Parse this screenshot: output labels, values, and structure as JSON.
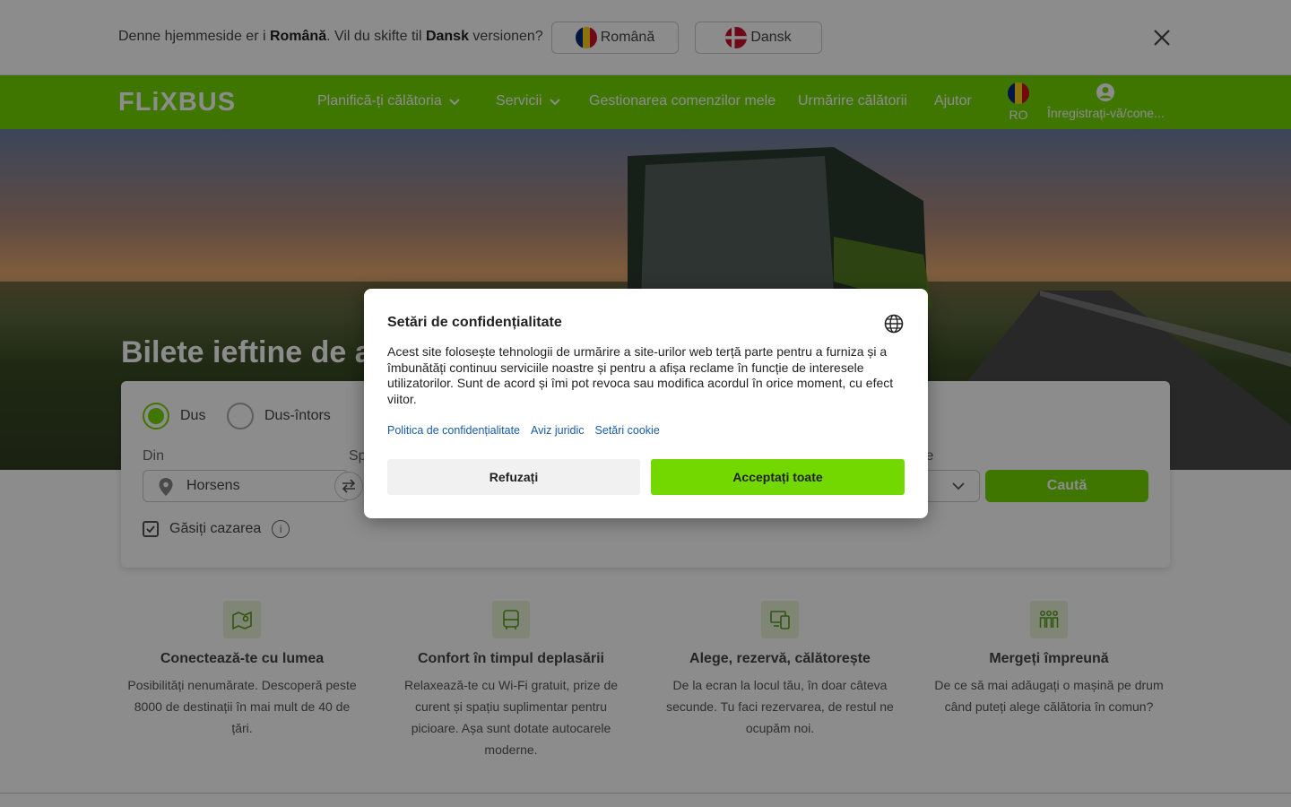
{
  "language_bar": {
    "prefix": "Denne hjemmeside er i ",
    "current_language": "Română",
    "middle": ". Vil du skifte til ",
    "target_language": "Dansk",
    "suffix": " versionen?",
    "button_romana": "Română",
    "button_dansk": "Dansk",
    "close_icon": "close-icon"
  },
  "header": {
    "logo_text": "FLiXBUS",
    "nav": [
      {
        "label": "Planifică-ți călătoria",
        "has_dropdown": true
      },
      {
        "label": "Servicii",
        "has_dropdown": true
      },
      {
        "label": "Gestionarea comenzilor mele",
        "has_dropdown": false
      },
      {
        "label": "Urmărire călătorii",
        "has_dropdown": false
      },
      {
        "label": "Ajutor",
        "has_dropdown": false
      }
    ],
    "language_code": "RO",
    "login_label": "Înregistrați-vă/cone..."
  },
  "hero": {
    "title": "Bilete ieftine de au"
  },
  "search": {
    "trip_one_way": "Dus",
    "trip_round": "Dus-întors",
    "from_label": "Din",
    "to_label_partial": "Sp",
    "passengers_label_partial": "te",
    "from_value": "Horsens",
    "search_button": "Caută",
    "accommodation_label": "Găsiți cazarea",
    "accommodation_checked": true,
    "selected_trip": "Dus"
  },
  "features": [
    {
      "icon": "map-pin-icon",
      "title": "Conectează-te cu lumea",
      "text": "Posibilități nenumărate. Descoperă peste 8000 de destinații în mai mult de 40 de țări."
    },
    {
      "icon": "bus-icon",
      "title": "Confort în timpul deplasării",
      "text": "Relaxează-te cu Wi-Fi gratuit, prize de curent și spațiu suplimentar pentru picioare. Așa sunt dotate autocarele moderne."
    },
    {
      "icon": "devices-icon",
      "title": "Alege, rezervă, călătorește",
      "text": "De la ecran la locul tău, în doar câteva secunde. Tu faci rezervarea, de restul ne ocupăm noi."
    },
    {
      "icon": "people-icon",
      "title": "Mergeți împreună",
      "text": "De ce să mai adăugați o mașină pe drum când puteți alege călătoria în comun?"
    }
  ],
  "privacy_modal": {
    "title": "Setări de confidențialitate",
    "text": "Acest site folosește tehnologii de urmărire a site-urilor web terță parte pentru a furniza și a îmbunătăți continuu serviciile noastre și pentru a afișa reclame în funcție de interesele utilizatorilor. Sunt de acord și îmi pot revoca sau modifica acordul în orice moment, cu efect viitor.",
    "links": [
      "Politica de confidențialitate",
      "Aviz juridic",
      "Setări cookie"
    ],
    "refuse_button": "Refuzați",
    "accept_button": "Acceptați toate"
  },
  "colors": {
    "brand_green": "#73d700",
    "link_blue": "#1a5aa6"
  }
}
